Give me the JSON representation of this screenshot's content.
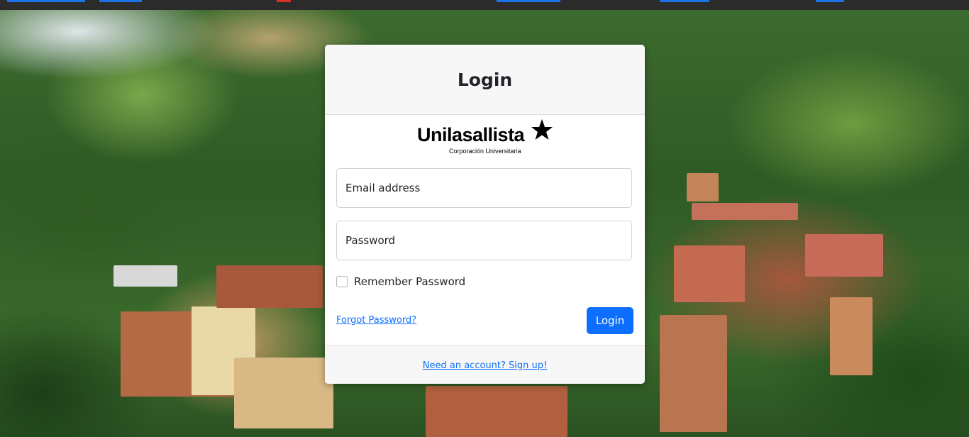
{
  "login": {
    "title": "Login",
    "email_placeholder": "Email address",
    "password_placeholder": "Password",
    "remember_label": "Remember Password",
    "forgot_link": "Forgot Password?",
    "submit_label": "Login",
    "signup_link": "Need an account? Sign up!"
  },
  "brand": {
    "name": "Unilasallista",
    "tagline": "Corporación Universitaria",
    "icon": "star-icon"
  },
  "colors": {
    "primary": "#0d6efd",
    "card_header": "#f7f7f7",
    "text": "#212529"
  }
}
